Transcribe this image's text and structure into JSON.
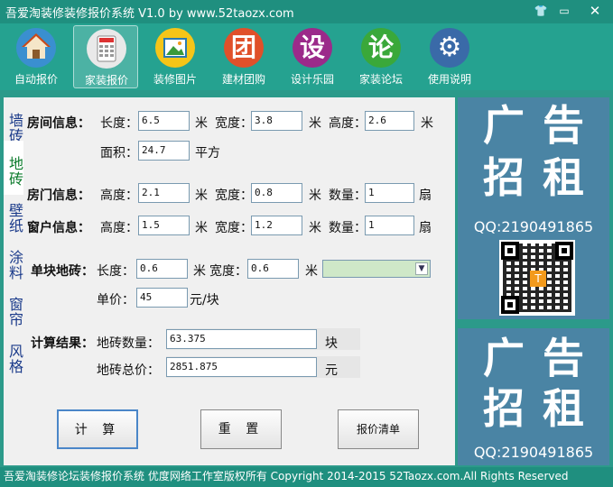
{
  "window": {
    "title": "吾爱淘装修装修报价系统 V1.0   by www.52taozx.com"
  },
  "toolbar": [
    {
      "label": "自动报价",
      "icon": "house-icon",
      "glyph": "",
      "color": "#3a8fd0"
    },
    {
      "label": "家装报价",
      "icon": "calculator-icon",
      "glyph": "",
      "color": "#e9e9e9"
    },
    {
      "label": "装修图片",
      "icon": "picture-icon",
      "glyph": "",
      "color": "#f5c518"
    },
    {
      "label": "建材团购",
      "icon": "tuan-icon",
      "glyph": "团",
      "color": "#e0502a"
    },
    {
      "label": "设计乐园",
      "icon": "she-icon",
      "glyph": "设",
      "color": "#9b2a8a"
    },
    {
      "label": "家装论坛",
      "icon": "lun-icon",
      "glyph": "论",
      "color": "#3aa83a"
    },
    {
      "label": "使用说明",
      "icon": "gear-icon",
      "glyph": "⚙",
      "color": "#3a6aa8"
    }
  ],
  "side_tabs": [
    "墙砖",
    "地砖",
    "壁纸",
    "涂料",
    "窗帘",
    "风格"
  ],
  "room": {
    "label": "房间信息：",
    "length_label": "长度：",
    "length": "6.5",
    "unit1": "米",
    "width_label": "宽度：",
    "width": "3.8",
    "unit2": "米",
    "height_label": "高度：",
    "height": "2.6",
    "unit3": "米",
    "area_label": "面积：",
    "area": "24.7",
    "area_unit": "平方"
  },
  "door": {
    "label": "房门信息：",
    "height_label": "高度：",
    "height": "2.1",
    "unit1": "米",
    "width_label": "宽度：",
    "width": "0.8",
    "unit2": "米",
    "count_label": "数量：",
    "count": "1",
    "count_unit": "扇"
  },
  "window_info": {
    "label": "窗户信息：",
    "height_label": "高度：",
    "height": "1.5",
    "unit1": "米",
    "width_label": "宽度：",
    "width": "1.2",
    "unit2": "米",
    "count_label": "数量：",
    "count": "1",
    "count_unit": "扇"
  },
  "tile": {
    "label": "单块地砖：",
    "length_label": "长度：",
    "length": "0.6",
    "unit1": "米",
    "width_label": "宽度：",
    "width": "0.6",
    "unit2": "米",
    "price_label": "单价：",
    "price": "45",
    "price_unit": "元/块"
  },
  "result": {
    "label": "计算结果：",
    "count_label": "地砖数量：",
    "count": "63.375",
    "count_unit": "块",
    "total_label": "地砖总价：",
    "total": "2851.875",
    "total_unit": "元"
  },
  "buttons": {
    "calc": "计 算",
    "reset": "重 置",
    "quote": "报价清单"
  },
  "ad": {
    "line1": "广告",
    "line2": "招租",
    "qq": "QQ:2190491865"
  },
  "status": "吾爱淘装修论坛装修报价系统    优度网络工作室版权所有  Copyright  2014-2015 52Taozx.com.All Rights Reserved"
}
